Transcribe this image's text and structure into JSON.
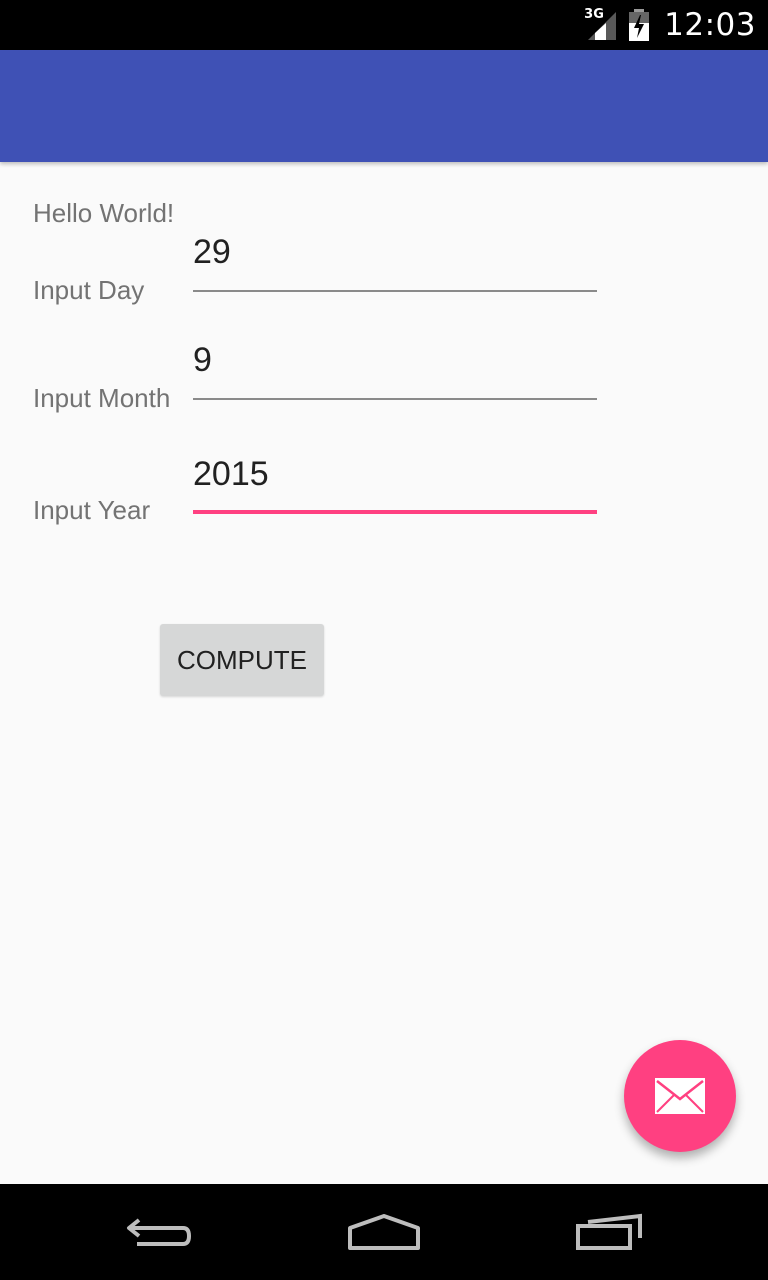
{
  "status_bar": {
    "network": "3G",
    "time": "12:03",
    "icons": [
      "signal-icon",
      "battery-charging-icon"
    ]
  },
  "colors": {
    "app_bar": "#3f51b5",
    "accent": "#ff4081",
    "button": "#d6d7d7"
  },
  "content": {
    "hello_text": "Hello World!",
    "fields": [
      {
        "label": "Input Day",
        "value": "29"
      },
      {
        "label": "Input Month",
        "value": "9"
      },
      {
        "label": "Input Year",
        "value": "2015"
      }
    ],
    "compute_label": "COMPUTE"
  },
  "fab": {
    "icon": "mail-icon"
  },
  "nav_bar": {
    "icons": [
      "back-icon",
      "home-icon",
      "recent-apps-icon"
    ]
  }
}
